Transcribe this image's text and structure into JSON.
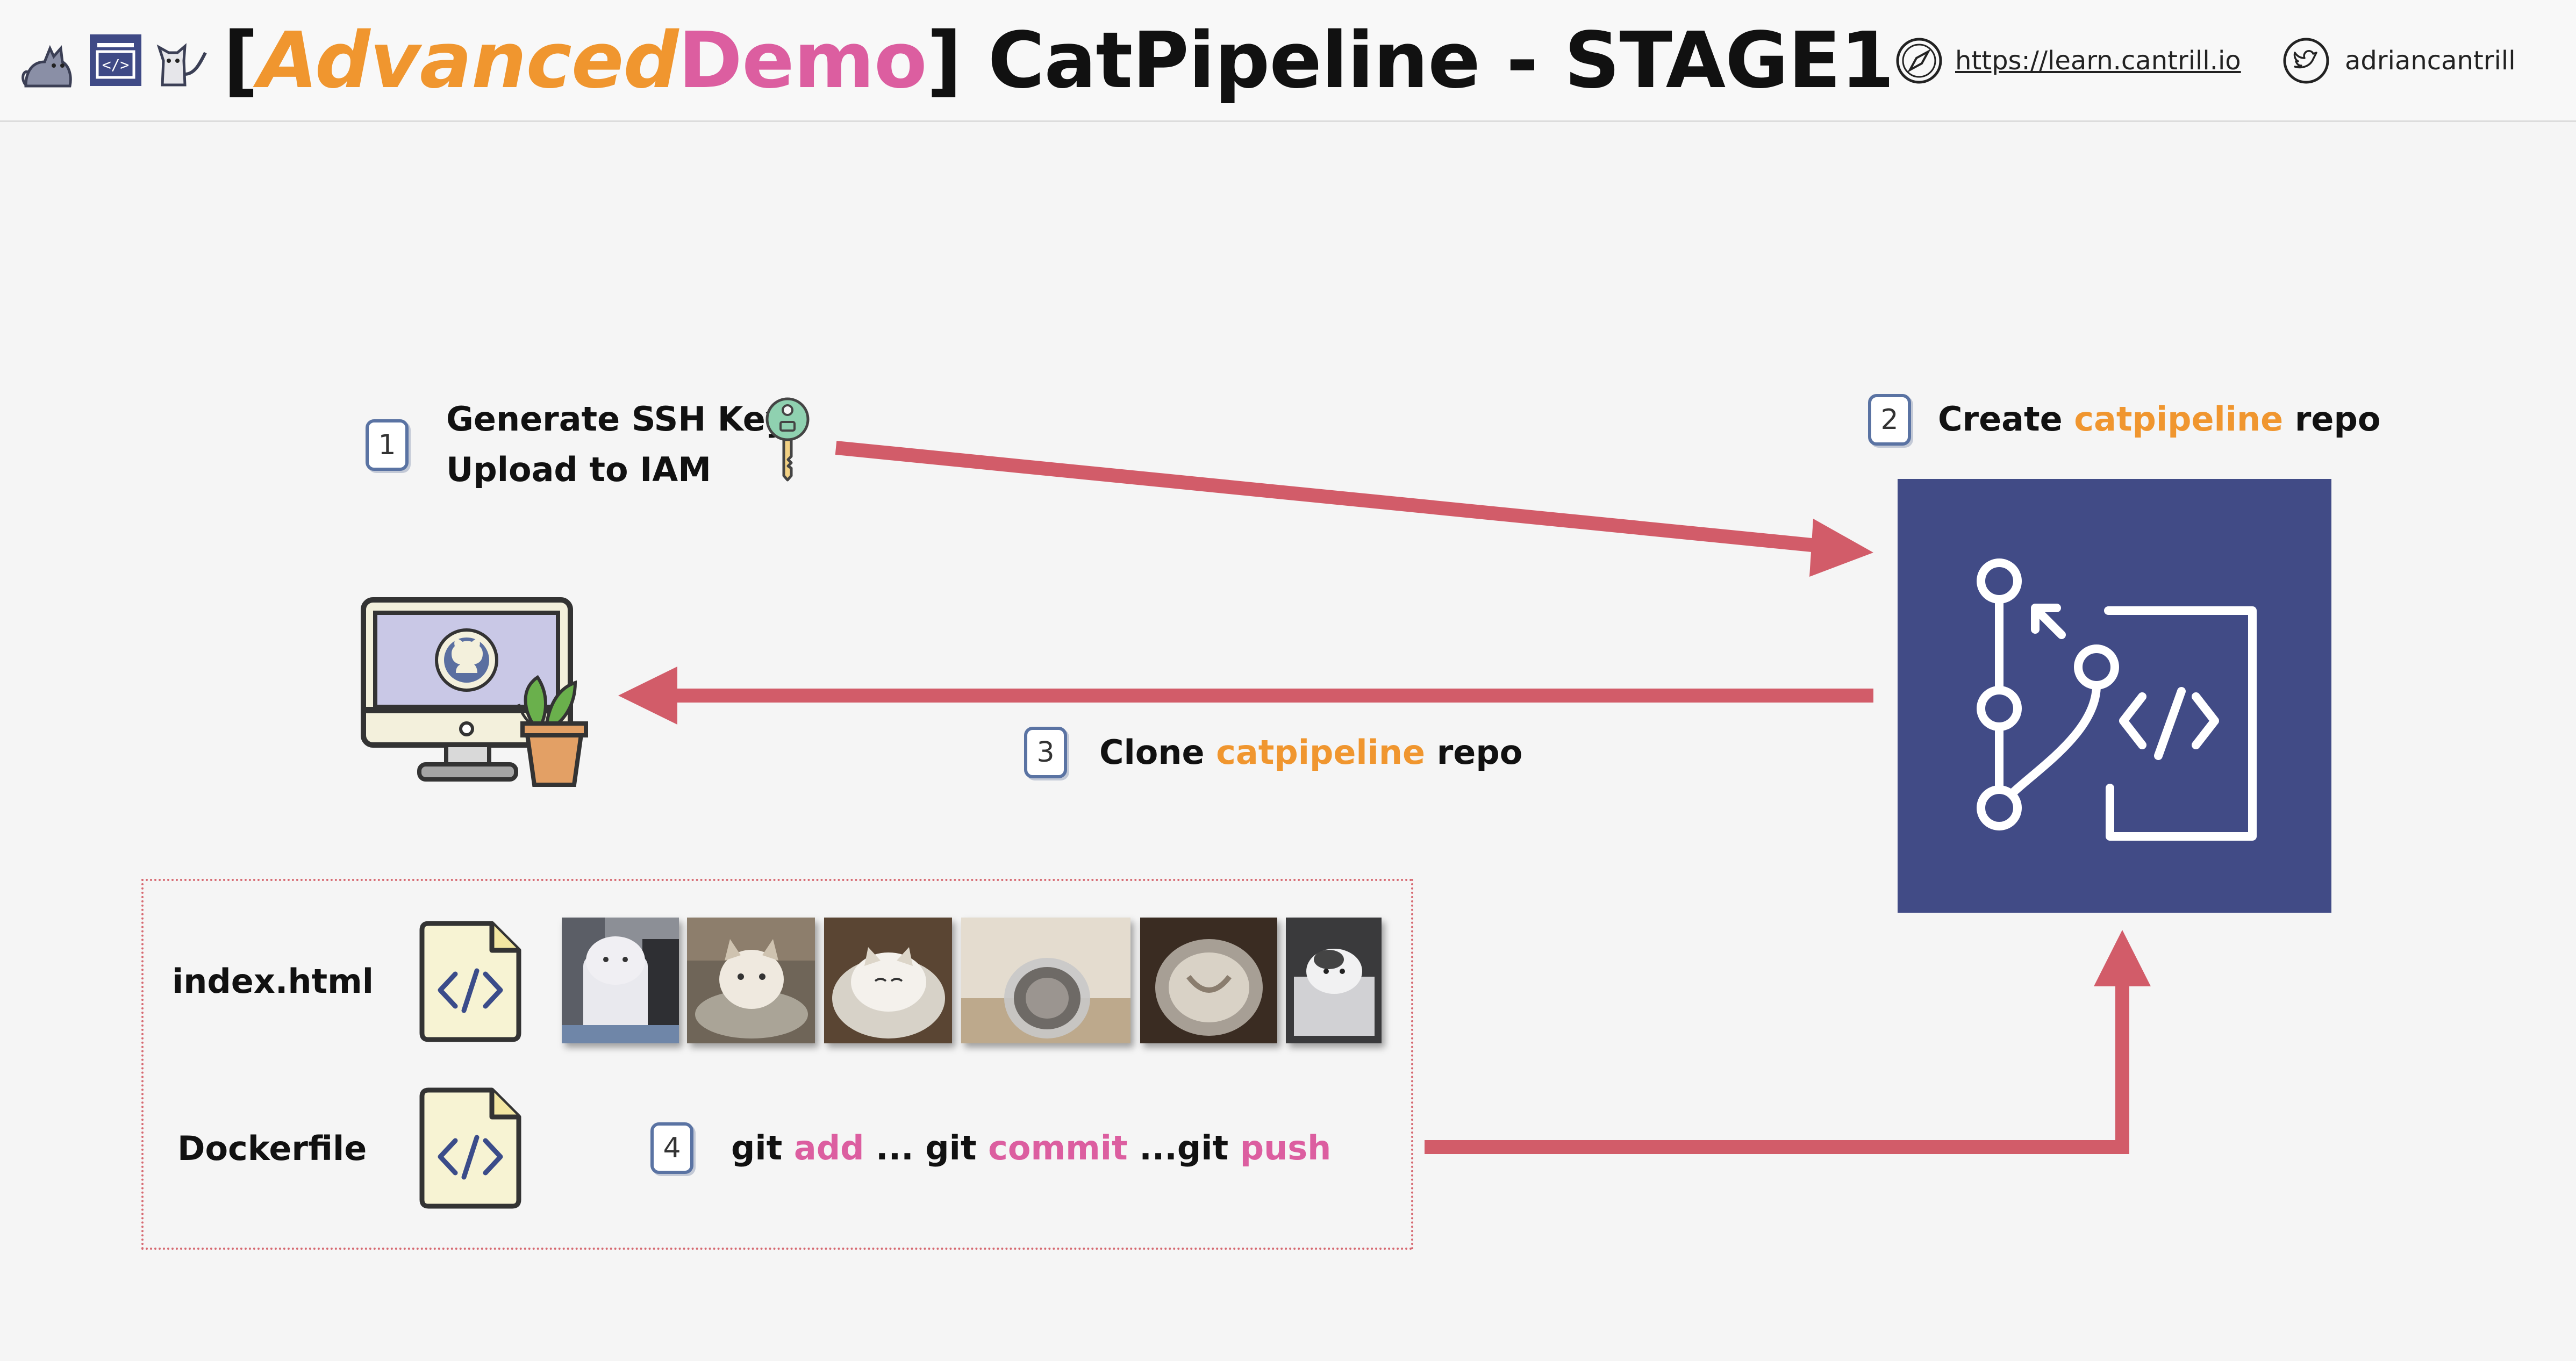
{
  "header": {
    "bracket_open": "[",
    "title_advanced": "Advanced",
    "title_demo": "Demo",
    "bracket_close": "]",
    "title_rest": " CatPipeline - STAGE1",
    "website": "https://learn.cantrill.io",
    "twitter": "adriancantrill",
    "icons": [
      "cat-icon",
      "code-window-icon",
      "cat-icon",
      "compass-icon",
      "twitter-icon"
    ]
  },
  "steps": {
    "step1": {
      "number": "1",
      "line1": "Generate SSH Key",
      "line2": "Upload to IAM"
    },
    "step2": {
      "number": "2",
      "prefix": "Create ",
      "highlight": "catpipeline",
      "suffix": " repo"
    },
    "step3": {
      "number": "3",
      "prefix": "Clone ",
      "highlight": "catpipeline",
      "suffix": " repo"
    },
    "step4": {
      "number": "4",
      "part1": "git ",
      "kw1": "add",
      "part2": " ... git ",
      "kw2": "commit",
      "part3": " ...git ",
      "kw3": "push"
    }
  },
  "files": {
    "index": "index.html",
    "docker": "Dockerfile"
  },
  "colors": {
    "arrow": "#d25c69",
    "repo_box": "#414b86",
    "orange": "#f0962f",
    "pink": "#dc5ea0"
  }
}
